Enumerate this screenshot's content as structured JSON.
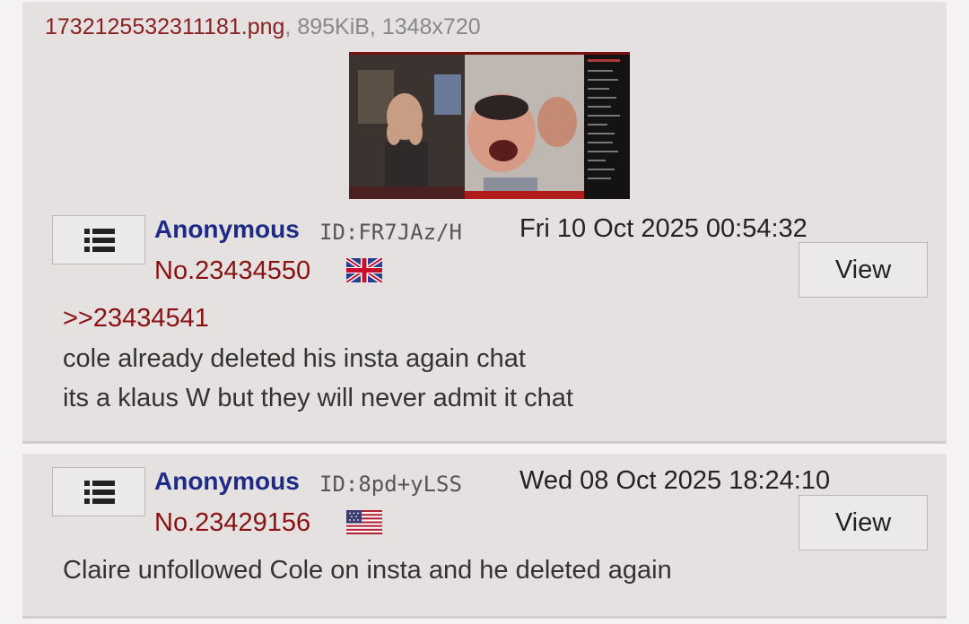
{
  "posts": [
    {
      "file": {
        "name": "1732125532311181.png",
        "meta": ", 895KiB, 1348x720"
      },
      "name": "Anonymous",
      "id": "ID:FR7JAz/H",
      "date": "Fri 10 Oct 2025 00:54:32",
      "number": "No.23434550",
      "flag": "uk-flag-icon",
      "view_label": "View",
      "quote": ">>23434541",
      "lines": [
        "cole already deleted his insta again chat",
        "its a klaus W but they will never admit it chat"
      ]
    },
    {
      "name": "Anonymous",
      "id": "ID:8pd+yLSS",
      "date": "Wed 08 Oct 2025 18:24:10",
      "number": "No.23429156",
      "flag": "us-flag-icon",
      "view_label": "View",
      "lines": [
        "Claire unfollowed Cole on insta and he deleted again"
      ]
    }
  ],
  "colors": {
    "name": "#1d2a86",
    "post_number": "#8a1111",
    "file_name": "#8a1f1f",
    "post_bg": "#e5e1e1"
  }
}
